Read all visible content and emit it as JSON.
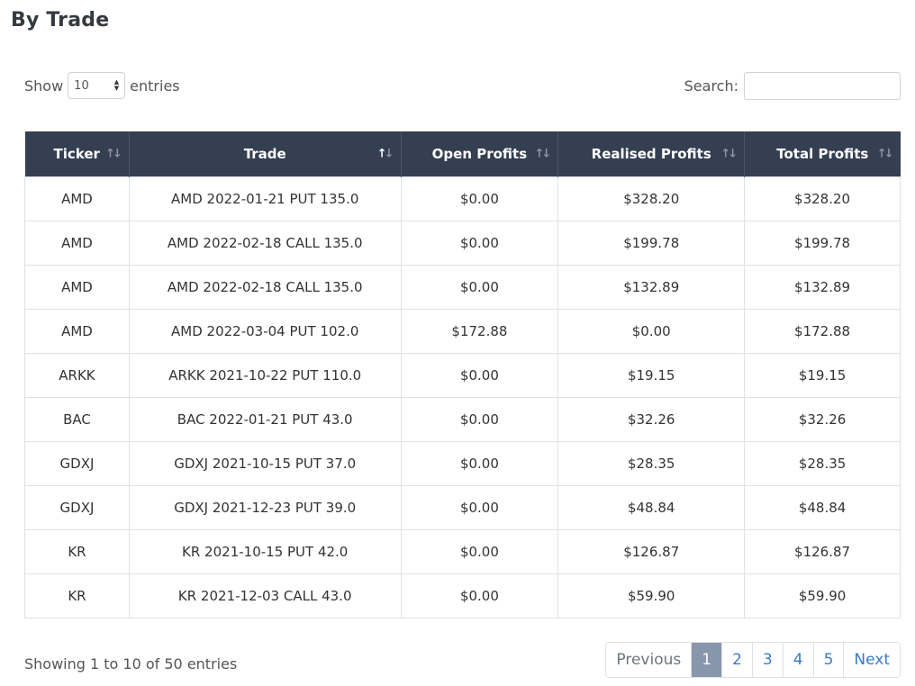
{
  "page": {
    "title": "By Trade"
  },
  "length_control": {
    "show_label": "Show",
    "selected_value": "10",
    "entries_label": "entries"
  },
  "search": {
    "label": "Search:",
    "value": ""
  },
  "table": {
    "headers": [
      "Ticker",
      "Trade",
      "Open Profits",
      "Realised Profits",
      "Total Profits"
    ],
    "sorted_column": "Trade",
    "rows": [
      [
        "AMD",
        "AMD 2022-01-21 PUT 135.0",
        "$0.00",
        "$328.20",
        "$328.20"
      ],
      [
        "AMD",
        "AMD 2022-02-18 CALL 135.0",
        "$0.00",
        "$199.78",
        "$199.78"
      ],
      [
        "AMD",
        "AMD 2022-02-18 CALL 135.0",
        "$0.00",
        "$132.89",
        "$132.89"
      ],
      [
        "AMD",
        "AMD 2022-03-04 PUT 102.0",
        "$172.88",
        "$0.00",
        "$172.88"
      ],
      [
        "ARKK",
        "ARKK 2021-10-22 PUT 110.0",
        "$0.00",
        "$19.15",
        "$19.15"
      ],
      [
        "BAC",
        "BAC 2022-01-21 PUT 43.0",
        "$0.00",
        "$32.26",
        "$32.26"
      ],
      [
        "GDXJ",
        "GDXJ 2021-10-15 PUT 37.0",
        "$0.00",
        "$28.35",
        "$28.35"
      ],
      [
        "GDXJ",
        "GDXJ 2021-12-23 PUT 39.0",
        "$0.00",
        "$48.84",
        "$48.84"
      ],
      [
        "KR",
        "KR 2021-10-15 PUT 42.0",
        "$0.00",
        "$126.87",
        "$126.87"
      ],
      [
        "KR",
        "KR 2021-12-03 CALL 43.0",
        "$0.00",
        "$59.90",
        "$59.90"
      ]
    ]
  },
  "footer": {
    "info": "Showing 1 to 10 of 50 entries",
    "pagination": {
      "previous": "Previous",
      "pages": [
        "1",
        "2",
        "3",
        "4",
        "5"
      ],
      "active_page": "1",
      "next": "Next"
    }
  },
  "colors": {
    "header_bg": "#343f52",
    "active_page_bg": "#8796ab",
    "link": "#3a7bc8"
  }
}
